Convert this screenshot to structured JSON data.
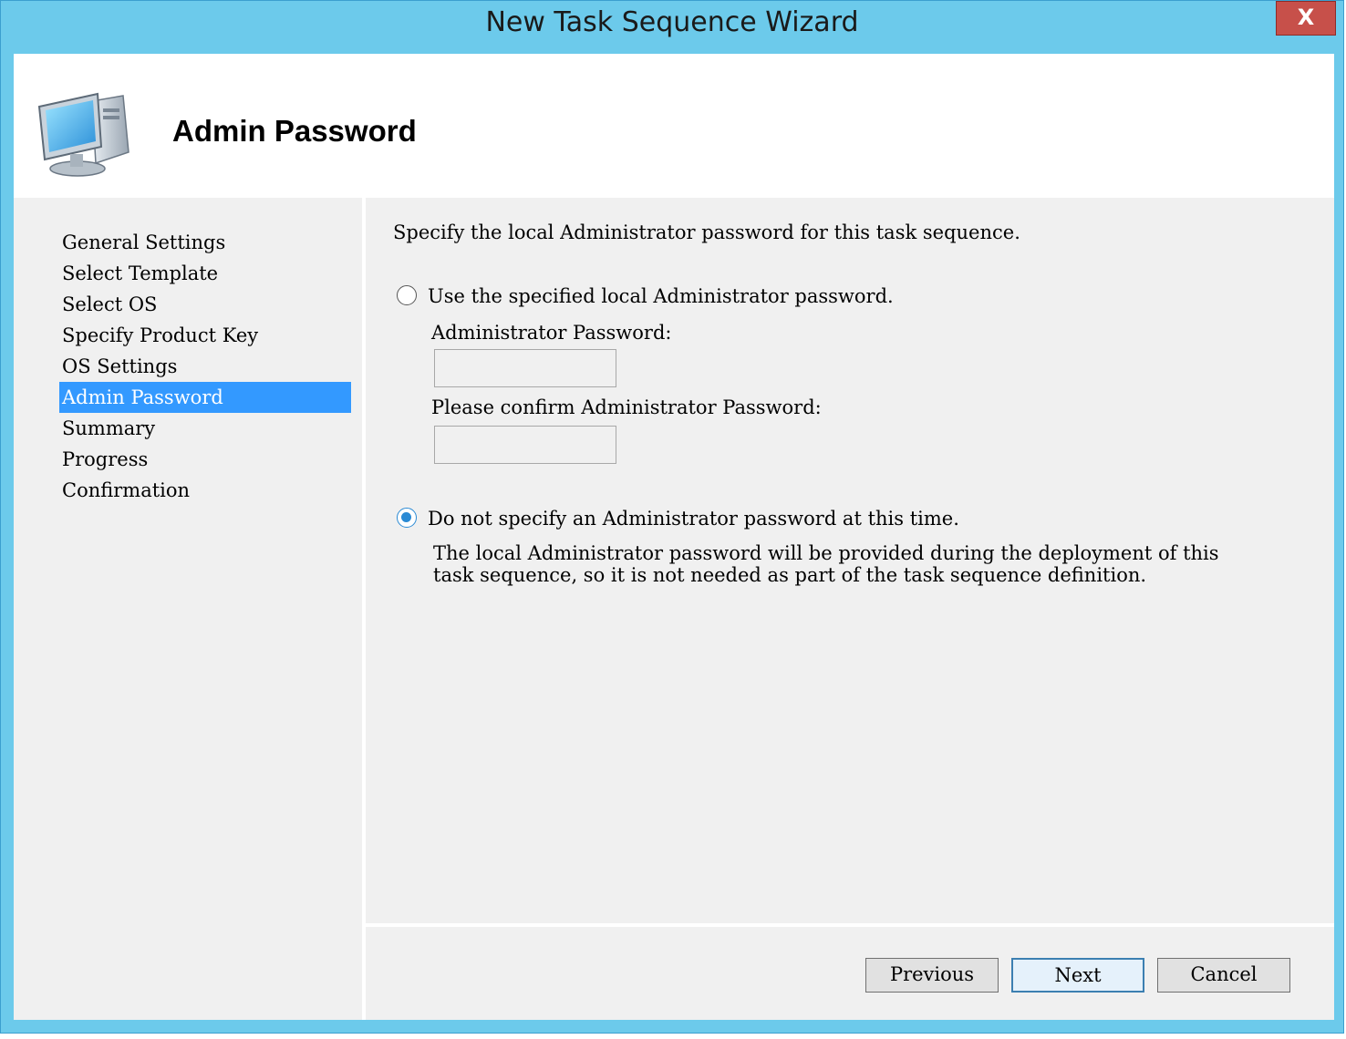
{
  "window": {
    "title": "New Task Sequence Wizard",
    "close_label": "X"
  },
  "header": {
    "title": "Admin Password",
    "icon": "computer-icon"
  },
  "nav": {
    "items": [
      {
        "label": "General Settings",
        "selected": false
      },
      {
        "label": "Select Template",
        "selected": false
      },
      {
        "label": "Select OS",
        "selected": false
      },
      {
        "label": "Specify Product Key",
        "selected": false
      },
      {
        "label": "OS Settings",
        "selected": false
      },
      {
        "label": "Admin Password",
        "selected": true
      },
      {
        "label": "Summary",
        "selected": false
      },
      {
        "label": "Progress",
        "selected": false
      },
      {
        "label": "Confirmation",
        "selected": false
      }
    ]
  },
  "content": {
    "intro": "Specify the local Administrator password for this task sequence.",
    "option_specify": {
      "label": "Use the specified local Administrator password.",
      "checked": false
    },
    "admin_password_label": "Administrator Password:",
    "admin_password_value": "",
    "confirm_password_label": "Please confirm Administrator Password:",
    "confirm_password_value": "",
    "option_none": {
      "label": "Do not specify an Administrator password at this time.",
      "checked": true,
      "description_line1": "The local Administrator password will be provided during the deployment of this",
      "description_line2": "task sequence, so it is not needed as part of the task sequence definition."
    }
  },
  "buttons": {
    "previous": "Previous",
    "next": "Next",
    "cancel": "Cancel"
  },
  "colors": {
    "title_bar": "#6ccaeb",
    "selection": "#3399ff",
    "close_button": "#c7504a"
  }
}
